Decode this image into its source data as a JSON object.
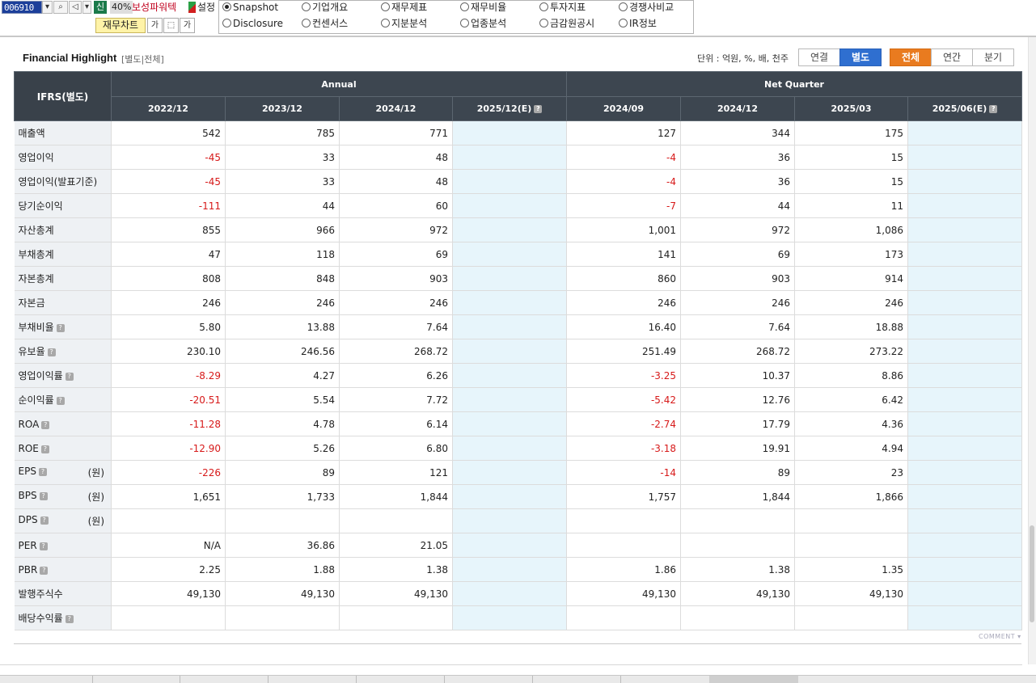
{
  "toolbar": {
    "stock_code": "006910",
    "shin_label": "신",
    "percent": "40%",
    "company_name": "보성파워텍",
    "settings_label": "설정",
    "chart_button": "재무차트",
    "tool_a": "가",
    "tool_b": "가"
  },
  "nav_radio": [
    {
      "label": "Snapshot",
      "checked": true
    },
    {
      "label": "기업개요",
      "checked": false
    },
    {
      "label": "재무제표",
      "checked": false
    },
    {
      "label": "재무비율",
      "checked": false
    },
    {
      "label": "투자지표",
      "checked": false
    },
    {
      "label": "경쟁사비교",
      "checked": false
    },
    {
      "label": "Disclosure",
      "checked": false
    },
    {
      "label": "컨센서스",
      "checked": false
    },
    {
      "label": "지분분석",
      "checked": false
    },
    {
      "label": "업종분석",
      "checked": false
    },
    {
      "label": "금감원공시",
      "checked": false
    },
    {
      "label": "IR정보",
      "checked": false
    }
  ],
  "section": {
    "title": "Financial Highlight",
    "subtitle": "[별도|전체]",
    "unit": "단위 : 억원, %, 배, 천주",
    "basis_toggle": [
      "연결",
      "별도"
    ],
    "basis_selected": "별도",
    "period_toggle": [
      "전체",
      "연간",
      "분기"
    ],
    "period_selected": "전체"
  },
  "table": {
    "corner": "IFRS(별도)",
    "group_annual": "Annual",
    "group_quarter": "Net Quarter",
    "columns": [
      "2022/12",
      "2023/12",
      "2024/12",
      "2025/12(E)",
      "2024/09",
      "2024/12",
      "2025/03",
      "2025/06(E)"
    ],
    "unit_won": "(원)",
    "help_icon": "?",
    "rows": [
      {
        "label": "매출액",
        "help": false,
        "unit": false,
        "values": [
          "542",
          "785",
          "771",
          "",
          "127",
          "344",
          "175",
          ""
        ]
      },
      {
        "label": "영업이익",
        "help": false,
        "unit": false,
        "values": [
          "-45",
          "33",
          "48",
          "",
          "-4",
          "36",
          "15",
          ""
        ]
      },
      {
        "label": "영업이익(발표기준)",
        "help": false,
        "unit": false,
        "values": [
          "-45",
          "33",
          "48",
          "",
          "-4",
          "36",
          "15",
          ""
        ]
      },
      {
        "label": "당기순이익",
        "help": false,
        "unit": false,
        "values": [
          "-111",
          "44",
          "60",
          "",
          "-7",
          "44",
          "11",
          ""
        ]
      },
      {
        "label": "자산총계",
        "help": false,
        "unit": false,
        "values": [
          "855",
          "966",
          "972",
          "",
          "1,001",
          "972",
          "1,086",
          ""
        ]
      },
      {
        "label": "부채총계",
        "help": false,
        "unit": false,
        "values": [
          "47",
          "118",
          "69",
          "",
          "141",
          "69",
          "173",
          ""
        ]
      },
      {
        "label": "자본총계",
        "help": false,
        "unit": false,
        "values": [
          "808",
          "848",
          "903",
          "",
          "860",
          "903",
          "914",
          ""
        ]
      },
      {
        "label": "자본금",
        "help": false,
        "unit": false,
        "values": [
          "246",
          "246",
          "246",
          "",
          "246",
          "246",
          "246",
          ""
        ]
      },
      {
        "label": "부채비율",
        "help": true,
        "unit": false,
        "values": [
          "5.80",
          "13.88",
          "7.64",
          "",
          "16.40",
          "7.64",
          "18.88",
          ""
        ]
      },
      {
        "label": "유보율",
        "help": true,
        "unit": false,
        "values": [
          "230.10",
          "246.56",
          "268.72",
          "",
          "251.49",
          "268.72",
          "273.22",
          ""
        ]
      },
      {
        "label": "영업이익률",
        "help": true,
        "unit": false,
        "values": [
          "-8.29",
          "4.27",
          "6.26",
          "",
          "-3.25",
          "10.37",
          "8.86",
          ""
        ]
      },
      {
        "label": "순이익률",
        "help": true,
        "unit": false,
        "values": [
          "-20.51",
          "5.54",
          "7.72",
          "",
          "-5.42",
          "12.76",
          "6.42",
          ""
        ]
      },
      {
        "label": "ROA",
        "help": true,
        "unit": false,
        "values": [
          "-11.28",
          "4.78",
          "6.14",
          "",
          "-2.74",
          "17.79",
          "4.36",
          ""
        ]
      },
      {
        "label": "ROE",
        "help": true,
        "unit": false,
        "values": [
          "-12.90",
          "5.26",
          "6.80",
          "",
          "-3.18",
          "19.91",
          "4.94",
          ""
        ]
      },
      {
        "label": "EPS",
        "help": true,
        "unit": true,
        "values": [
          "-226",
          "89",
          "121",
          "",
          "-14",
          "89",
          "23",
          ""
        ]
      },
      {
        "label": "BPS",
        "help": true,
        "unit": true,
        "values": [
          "1,651",
          "1,733",
          "1,844",
          "",
          "1,757",
          "1,844",
          "1,866",
          ""
        ]
      },
      {
        "label": "DPS",
        "help": true,
        "unit": true,
        "values": [
          "",
          "",
          "",
          "",
          "",
          "",
          "",
          ""
        ]
      },
      {
        "label": "PER",
        "help": true,
        "unit": false,
        "values": [
          "N/A",
          "36.86",
          "21.05",
          "",
          "",
          "",
          "",
          ""
        ]
      },
      {
        "label": "PBR",
        "help": true,
        "unit": false,
        "values": [
          "2.25",
          "1.88",
          "1.38",
          "",
          "1.86",
          "1.38",
          "1.35",
          ""
        ]
      },
      {
        "label": "발행주식수",
        "help": false,
        "unit": false,
        "values": [
          "49,130",
          "49,130",
          "49,130",
          "",
          "49,130",
          "49,130",
          "49,130",
          ""
        ]
      },
      {
        "label": "배당수익률",
        "help": true,
        "unit": false,
        "values": [
          "",
          "",
          "",
          "",
          "",
          "",
          "",
          ""
        ]
      }
    ]
  },
  "comment_label": "COMMENT",
  "colors": {
    "header_bg": "#3d4650",
    "label_bg": "#eef1f4",
    "estimate_bg": "#e7f5fb",
    "negative": "#d71a1a",
    "basis_active": "#2f6fd0",
    "period_active": "#e97b1f"
  }
}
